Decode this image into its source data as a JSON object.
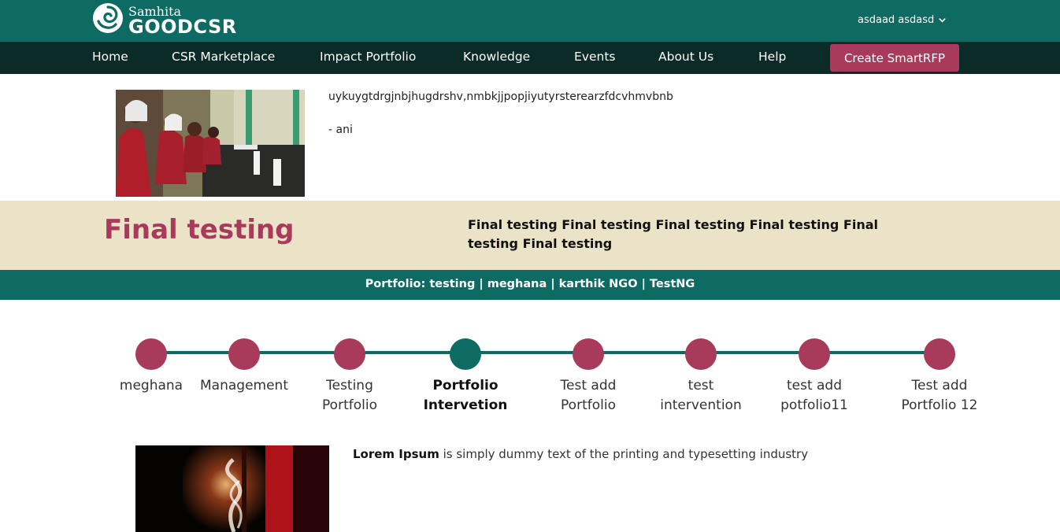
{
  "brand": {
    "small": "Samhita",
    "big": "GOODCSR"
  },
  "user": {
    "name": "asdaad asdasd"
  },
  "nav": {
    "items": [
      "Home",
      "CSR Marketplace",
      "Impact Portfolio",
      "Knowledge",
      "Events",
      "About Us",
      "Help"
    ],
    "cta": "Create SmartRFP"
  },
  "intro": {
    "quote": "uykuygtdrgjnbjhugdrshv,nmbkjjpopjiyutyrsterearzfdcvhmvbnb",
    "author": "- ani"
  },
  "banner": {
    "title": "Final testing",
    "description": "Final testing Final testing Final testing Final testing Final testing Final testing"
  },
  "portfolio_line": "Portfolio: testing | meghana | karthik NGO | TestNG",
  "timeline": {
    "steps": [
      {
        "label_1": "meghana",
        "label_2": ""
      },
      {
        "label_1": "Management",
        "label_2": ""
      },
      {
        "label_1": "Testing",
        "label_2": "Portfolio"
      },
      {
        "label_1": "Portfolio",
        "label_2": "Intervetion"
      },
      {
        "label_1": "Test add",
        "label_2": "Portfolio"
      },
      {
        "label_1": "test",
        "label_2": "intervention"
      },
      {
        "label_1": "test add",
        "label_2": "potfolio11"
      },
      {
        "label_1": "Test add",
        "label_2": "Portfolio 12"
      }
    ],
    "active_index": 3
  },
  "detail": {
    "bold": "Lorem Ipsum",
    "text": " is simply dummy text of the printing and typesetting industry"
  },
  "colors": {
    "teal": "#0d6b63",
    "dark_nav": "#0a2b27",
    "accent": "#a83b5b",
    "band": "#ebe3c8"
  }
}
